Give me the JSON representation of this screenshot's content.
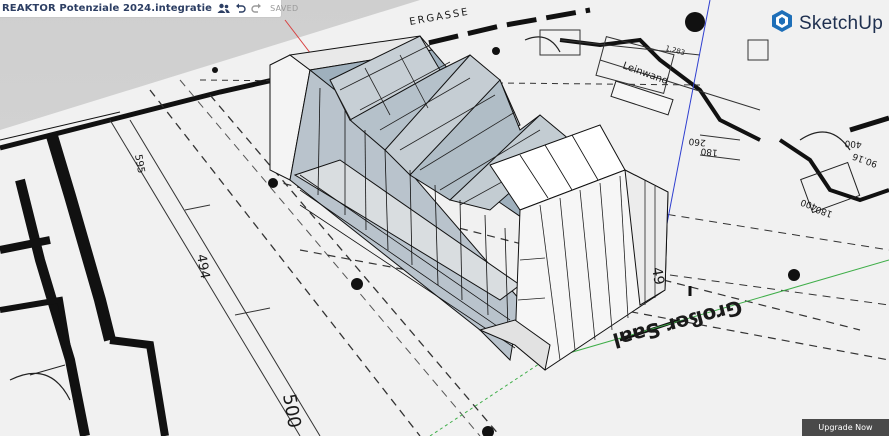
{
  "document": {
    "title": "REAKTOR Potenziale 2024.integratie",
    "save_status": "SAVED"
  },
  "toolbar": {
    "icons": [
      "share-users-icon",
      "undo-icon",
      "redo-icon"
    ]
  },
  "brand": {
    "name": "SketchUp",
    "color": "#1e6fb8"
  },
  "upgrade_button": {
    "label": "Upgrade Now"
  },
  "floorplan_labels": {
    "street": "ERGASSE",
    "projection": "Leinwand",
    "dim_top": "1.283",
    "dim_595": "595",
    "dim_494": "494",
    "dim_500": "500",
    "dim_180": "180",
    "dim_260": "260",
    "dim_400a": "400",
    "dim_90_16": "90.16",
    "dim_400b": "400",
    "dim_180b": "180",
    "room_name": "Großer Saal",
    "room_prefix": "49"
  },
  "axes_colors": {
    "red": "#d84040",
    "green": "#3fae49",
    "blue": "#2f3fd0"
  }
}
